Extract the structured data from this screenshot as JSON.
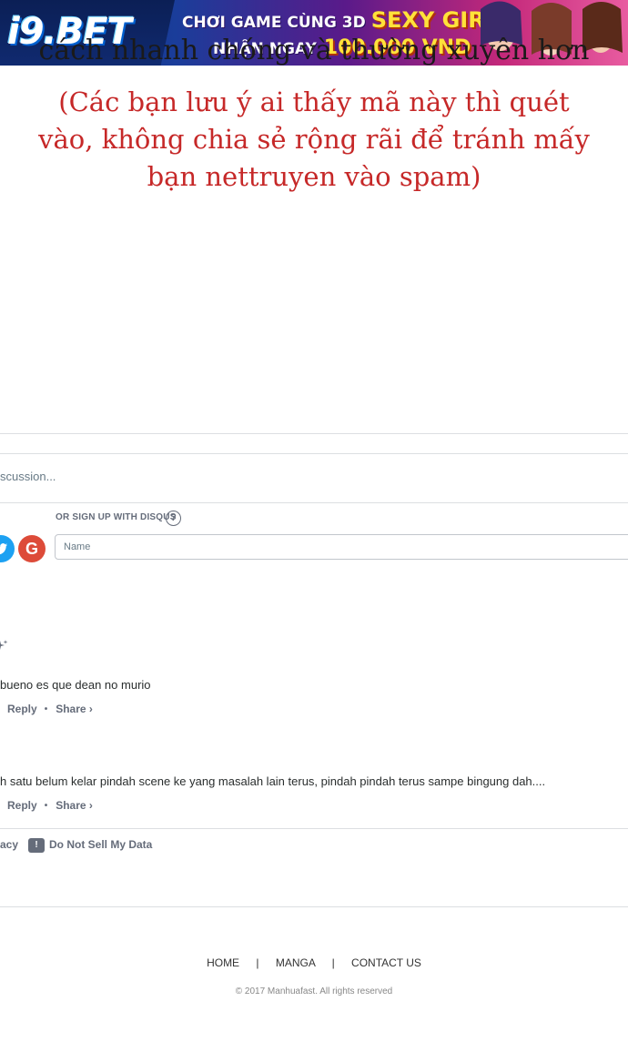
{
  "banner": {
    "logo": "i9.BET",
    "line1_prefix": "CHƠI GAME CÙNG 3D",
    "line1_highlight": "SEXY GIRL",
    "line2_prefix": "NHẬN NGAY",
    "line2_highlight": "100.000 VND",
    "colors": {
      "brand_yellow": "#ffe23a",
      "brand_blue": "#0b1f55",
      "brand_pink": "#e85ca0"
    }
  },
  "comic": {
    "cut_text": "cách nhanh chóng và thường xuyên hơn",
    "note_line1": "(Các bạn lưu ý ai thấy mã này thì quét",
    "note_line2": "vào, không chia sẻ rộng rãi để tránh mấy",
    "note_line3": "bạn nettruyen vào spam)",
    "note_color": "#c62828"
  },
  "disqus": {
    "discussion_placeholder": "scussion...",
    "signup_label": "OR SIGN UP WITH DISQUS",
    "help_symbol": "?",
    "google_letter": "G",
    "name_placeholder": "Name",
    "sort_icon": "sparkle-icon",
    "comments": [
      {
        "text": "bueno es que dean no murio",
        "reply_label": "Reply",
        "share_label": "Share ›"
      },
      {
        "text": "h satu belum kelar pindah scene ke yang masalah lain terus, pindah pindah terus sampe bingung dah....",
        "reply_label": "Reply",
        "share_label": "Share ›"
      }
    ],
    "privacy_label": "acy",
    "notsell_icon": "!",
    "notsell_label": "Do Not Sell My Data"
  },
  "footer": {
    "nav": [
      "HOME",
      "MANGA",
      "CONTACT US"
    ],
    "separator": "|",
    "copyright": "© 2017 Manhuafast. All rights reserved"
  }
}
